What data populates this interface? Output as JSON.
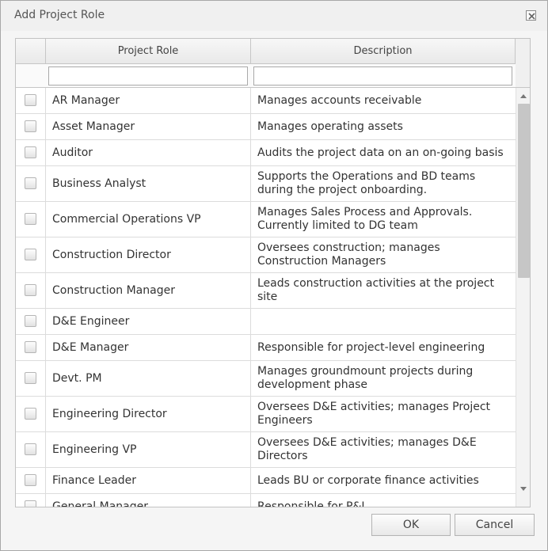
{
  "dialog": {
    "title": "Add Project Role",
    "ok_label": "OK",
    "cancel_label": "Cancel"
  },
  "grid": {
    "columns": [
      "Project Role",
      "Description"
    ],
    "filters": {
      "role_value": "",
      "description_value": ""
    },
    "rows": [
      {
        "role": "AR Manager",
        "description": "Manages accounts receivable",
        "checked": false
      },
      {
        "role": "Asset Manager",
        "description": "Manages operating assets",
        "checked": false
      },
      {
        "role": "Auditor",
        "description": "Audits the project data on an on-going basis",
        "checked": false
      },
      {
        "role": "Business Analyst",
        "description": "Supports the Operations and BD teams during the project onboarding.",
        "checked": false
      },
      {
        "role": "Commercial Operations VP",
        "description": "Manages Sales Process and Approvals. Currently limited to DG team",
        "checked": false
      },
      {
        "role": "Construction Director",
        "description": "Oversees construction; manages Construction Managers",
        "checked": false
      },
      {
        "role": "Construction Manager",
        "description": "Leads construction activities at the project site",
        "checked": false
      },
      {
        "role": "D&E Engineer",
        "description": "",
        "checked": false
      },
      {
        "role": "D&E Manager",
        "description": "Responsible for project-level engineering",
        "checked": false
      },
      {
        "role": "Devt. PM",
        "description": "Manages groundmount projects during development phase",
        "checked": false
      },
      {
        "role": "Engineering Director",
        "description": "Oversees D&E activities; manages Project Engineers",
        "checked": false
      },
      {
        "role": "Engineering VP",
        "description": "Oversees D&E activities; manages D&E Directors",
        "checked": false
      },
      {
        "role": "Finance Leader",
        "description": "Leads BU or corporate finance activities",
        "checked": false
      },
      {
        "role": "General Manager",
        "description": "Responsible for P&L",
        "checked": false
      }
    ]
  },
  "icons": {
    "close": "close-icon",
    "scroll_up": "arrow-up-icon",
    "scroll_down": "arrow-down-icon"
  }
}
